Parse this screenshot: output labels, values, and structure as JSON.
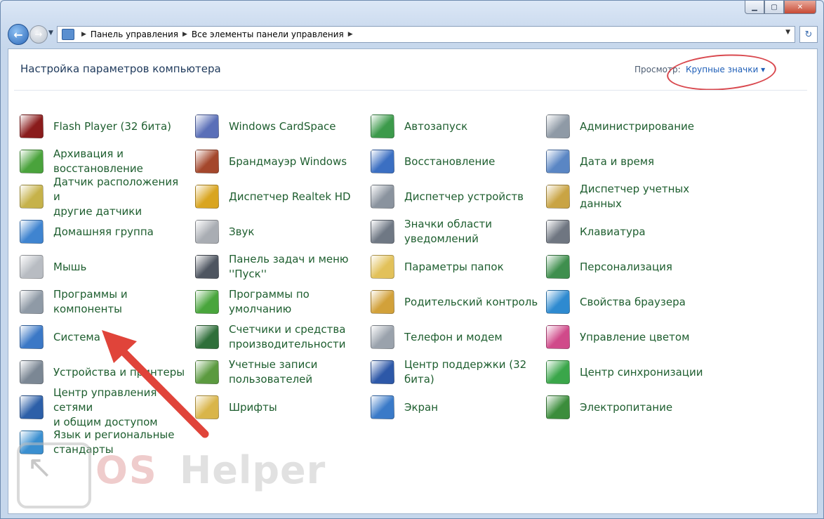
{
  "window": {
    "minimize_glyph": "▁",
    "maximize_glyph": "▢",
    "close_glyph": "✕"
  },
  "nav": {
    "back_glyph": "←",
    "forward_glyph": "→",
    "refresh_glyph": "↻",
    "breadcrumb": [
      "Панель управления",
      "Все элементы панели управления"
    ]
  },
  "header": {
    "title": "Настройка параметров компьютера",
    "view_label": "Просмотр:",
    "view_value": "Крупные значки ▾"
  },
  "columns": [
    [
      {
        "label": "Flash Player (32 бита)",
        "icon": "flash-player-icon",
        "color": "#8a1c1c"
      },
      {
        "label": "Архивация и\nвосстановление",
        "icon": "backup-restore-icon",
        "color": "#4aa33c"
      },
      {
        "label": "Датчик расположения и\nдругие датчики",
        "icon": "location-sensor-icon",
        "color": "#c6b24a"
      },
      {
        "label": "Домашняя группа",
        "icon": "homegroup-icon",
        "color": "#3f84d0"
      },
      {
        "label": "Мышь",
        "icon": "mouse-icon",
        "color": "#b8bcc2"
      },
      {
        "label": "Программы и\nкомпоненты",
        "icon": "programs-features-icon",
        "color": "#8f9aa6"
      },
      {
        "label": "Система",
        "icon": "system-icon",
        "color": "#3b78c6"
      },
      {
        "label": "Устройства и принтеры",
        "icon": "devices-printers-icon",
        "color": "#7b8794"
      },
      {
        "label": "Центр управления сетями\nи общим доступом",
        "icon": "network-center-icon",
        "color": "#2c5fa8"
      },
      {
        "label": "Язык и региональные\nстандарты",
        "icon": "region-language-icon",
        "color": "#3a8fd0"
      }
    ],
    [
      {
        "label": "Windows CardSpace",
        "icon": "cardspace-icon",
        "color": "#5a6fb8"
      },
      {
        "label": "Брандмауэр Windows",
        "icon": "firewall-icon",
        "color": "#a4472c"
      },
      {
        "label": "Диспетчер Realtek HD",
        "icon": "realtek-icon",
        "color": "#d9a520"
      },
      {
        "label": "Звук",
        "icon": "sound-icon",
        "color": "#a9adb3"
      },
      {
        "label": "Панель задач и меню\n''Пуск''",
        "icon": "taskbar-icon",
        "color": "#4e5560"
      },
      {
        "label": "Программы по\nумолчанию",
        "icon": "default-programs-icon",
        "color": "#49a53c"
      },
      {
        "label": "Счетчики и средства\nпроизводительности",
        "icon": "performance-icon",
        "color": "#2f6f3a"
      },
      {
        "label": "Учетные записи\nпользователей",
        "icon": "user-accounts-icon",
        "color": "#5b9a3f"
      },
      {
        "label": "Шрифты",
        "icon": "fonts-icon",
        "color": "#d9b54a"
      }
    ],
    [
      {
        "label": "Автозапуск",
        "icon": "autoplay-icon",
        "color": "#3c9a4b"
      },
      {
        "label": "Восстановление",
        "icon": "recovery-icon",
        "color": "#3b6fc2"
      },
      {
        "label": "Диспетчер устройств",
        "icon": "device-manager-icon",
        "color": "#8a939e"
      },
      {
        "label": "Значки области\nуведомлений",
        "icon": "notification-icons-icon",
        "color": "#6f7884"
      },
      {
        "label": "Параметры папок",
        "icon": "folder-options-icon",
        "color": "#e2c15a"
      },
      {
        "label": "Родительский контроль",
        "icon": "parental-controls-icon",
        "color": "#d2a13a"
      },
      {
        "label": "Телефон и модем",
        "icon": "phone-modem-icon",
        "color": "#9aa2ac"
      },
      {
        "label": "Центр поддержки (32\nбита)",
        "icon": "action-center-icon",
        "color": "#2d58a8"
      },
      {
        "label": "Экран",
        "icon": "display-icon",
        "color": "#3a7ac8"
      }
    ],
    [
      {
        "label": "Администрирование",
        "icon": "administrative-tools-icon",
        "color": "#8f9aa6"
      },
      {
        "label": "Дата и время",
        "icon": "date-time-icon",
        "color": "#5a86c4"
      },
      {
        "label": "Диспетчер учетных\nданных",
        "icon": "credential-manager-icon",
        "color": "#c9a444"
      },
      {
        "label": "Клавиатура",
        "icon": "keyboard-icon",
        "color": "#6f7681"
      },
      {
        "label": "Персонализация",
        "icon": "personalization-icon",
        "color": "#3f8f4e"
      },
      {
        "label": "Свойства браузера",
        "icon": "internet-options-icon",
        "color": "#2e8ad0"
      },
      {
        "label": "Управление цветом",
        "icon": "color-management-icon",
        "color": "#d04a8a"
      },
      {
        "label": "Центр синхронизации",
        "icon": "sync-center-icon",
        "color": "#3aa64a"
      },
      {
        "label": "Электропитание",
        "icon": "power-options-icon",
        "color": "#3c8d3c"
      }
    ]
  ],
  "watermark": {
    "brand_part1": "OS",
    "brand_part2": "Helper"
  },
  "colors": {
    "link_text": "#1e5e2f",
    "annotation_red": "#e0443a"
  }
}
